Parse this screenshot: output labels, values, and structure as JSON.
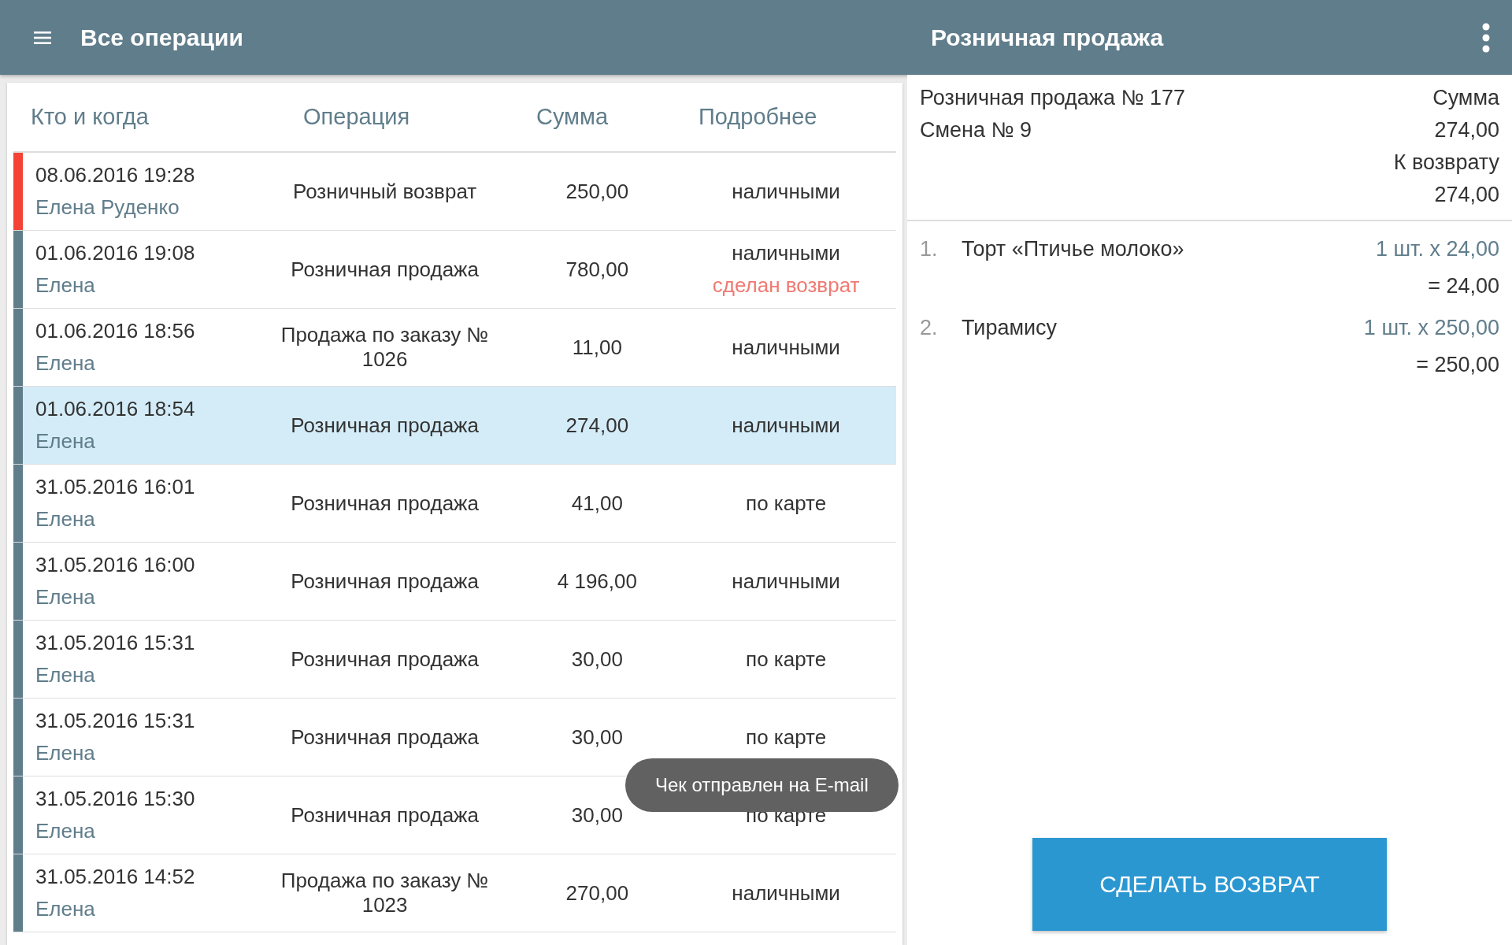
{
  "app_bar": {
    "title": "Все операции",
    "detail_title": "Розничная продажа"
  },
  "table": {
    "columns": [
      "Кто и когда",
      "Операция",
      "Сумма",
      "Подробнее"
    ],
    "rows": [
      {
        "date": "08.06.2016 19:28",
        "user": "Елена Руденко",
        "operation": "Розничный возврат",
        "sum": "250,00",
        "details": "наличными",
        "color": "#f44336",
        "selected": false
      },
      {
        "date": "01.06.2016 19:08",
        "user": "Елена",
        "operation": "Розничная продажа",
        "sum": "780,00",
        "details": "наличными",
        "note": "сделан возврат",
        "color": "#607d8b",
        "selected": false
      },
      {
        "date": "01.06.2016 18:56",
        "user": "Елена",
        "operation": "Продажа по заказу № 1026",
        "sum": "11,00",
        "details": "наличными",
        "color": "#607d8b",
        "selected": false
      },
      {
        "date": "01.06.2016 18:54",
        "user": "Елена",
        "operation": "Розничная продажа",
        "sum": "274,00",
        "details": "наличными",
        "color": "#607d8b",
        "selected": true
      },
      {
        "date": "31.05.2016 16:01",
        "user": "Елена",
        "operation": "Розничная продажа",
        "sum": "41,00",
        "details": "по карте",
        "color": "#607d8b",
        "selected": false
      },
      {
        "date": "31.05.2016 16:00",
        "user": "Елена",
        "operation": "Розничная продажа",
        "sum": "4 196,00",
        "details": "наличными",
        "color": "#607d8b",
        "selected": false
      },
      {
        "date": "31.05.2016 15:31",
        "user": "Елена",
        "operation": "Розничная продажа",
        "sum": "30,00",
        "details": "по карте",
        "color": "#607d8b",
        "selected": false
      },
      {
        "date": "31.05.2016 15:31",
        "user": "Елена",
        "operation": "Розничная продажа",
        "sum": "30,00",
        "details": "по карте",
        "color": "#607d8b",
        "selected": false
      },
      {
        "date": "31.05.2016 15:30",
        "user": "Елена",
        "operation": "Розничная продажа",
        "sum": "30,00",
        "details": "по карте",
        "color": "#607d8b",
        "selected": false
      },
      {
        "date": "31.05.2016 14:52",
        "user": "Елена",
        "operation": "Продажа по заказу № 1023",
        "sum": "270,00",
        "details": "наличными",
        "color": "#607d8b",
        "selected": false
      }
    ]
  },
  "toast": "Чек отправлен на E-mail",
  "detail": {
    "title": "Розничная продажа № 177",
    "shift": "Смена № 9",
    "sum_label": "Сумма",
    "sum": "274,00",
    "refund_label": "К возврату",
    "refund": "274,00",
    "items": [
      {
        "number": "1.",
        "name": "Торт «Птичье молоко»",
        "qty": "1 шт. x 24,00",
        "total": "= 24,00"
      },
      {
        "number": "2.",
        "name": "Тирамису",
        "qty": "1 шт. x 250,00",
        "total": "= 250,00"
      }
    ],
    "button": "СДЕЛАТЬ ВОЗВРАТ"
  }
}
